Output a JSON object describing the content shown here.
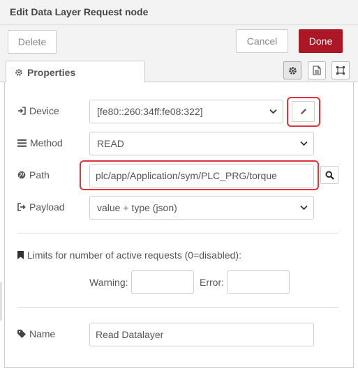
{
  "dialog": {
    "title": "Edit Data Layer Request node"
  },
  "toolbar": {
    "delete_label": "Delete",
    "cancel_label": "Cancel",
    "done_label": "Done",
    "done_color": "#ad1625"
  },
  "tabs": {
    "properties_label": "Properties",
    "icons": [
      "gear-icon",
      "document-icon",
      "frame-icon"
    ]
  },
  "form": {
    "device": {
      "label": "Device",
      "icon": "sign-in-icon",
      "value": "[fe80::260:34ff:fe08:322]",
      "edit_icon": "pencil-icon"
    },
    "method": {
      "label": "Method",
      "icon": "list-icon",
      "value": "READ"
    },
    "path": {
      "label": "Path",
      "icon": "globe-icon",
      "value": "plc/app/Application/sym/PLC_PRG/torque",
      "browse_icon": "search-icon"
    },
    "payload": {
      "label": "Payload",
      "icon": "sign-out-icon",
      "value": "value + type (json)"
    },
    "limits": {
      "label": "Limits for number of active requests (0=disabled):",
      "icon": "bookmark-icon",
      "warning_label": "Warning:",
      "warning_value": "",
      "error_label": "Error:",
      "error_value": ""
    },
    "name": {
      "label": "Name",
      "icon": "tag-icon",
      "value": "Read Datalayer"
    }
  },
  "highlight_color": "#e0323b"
}
